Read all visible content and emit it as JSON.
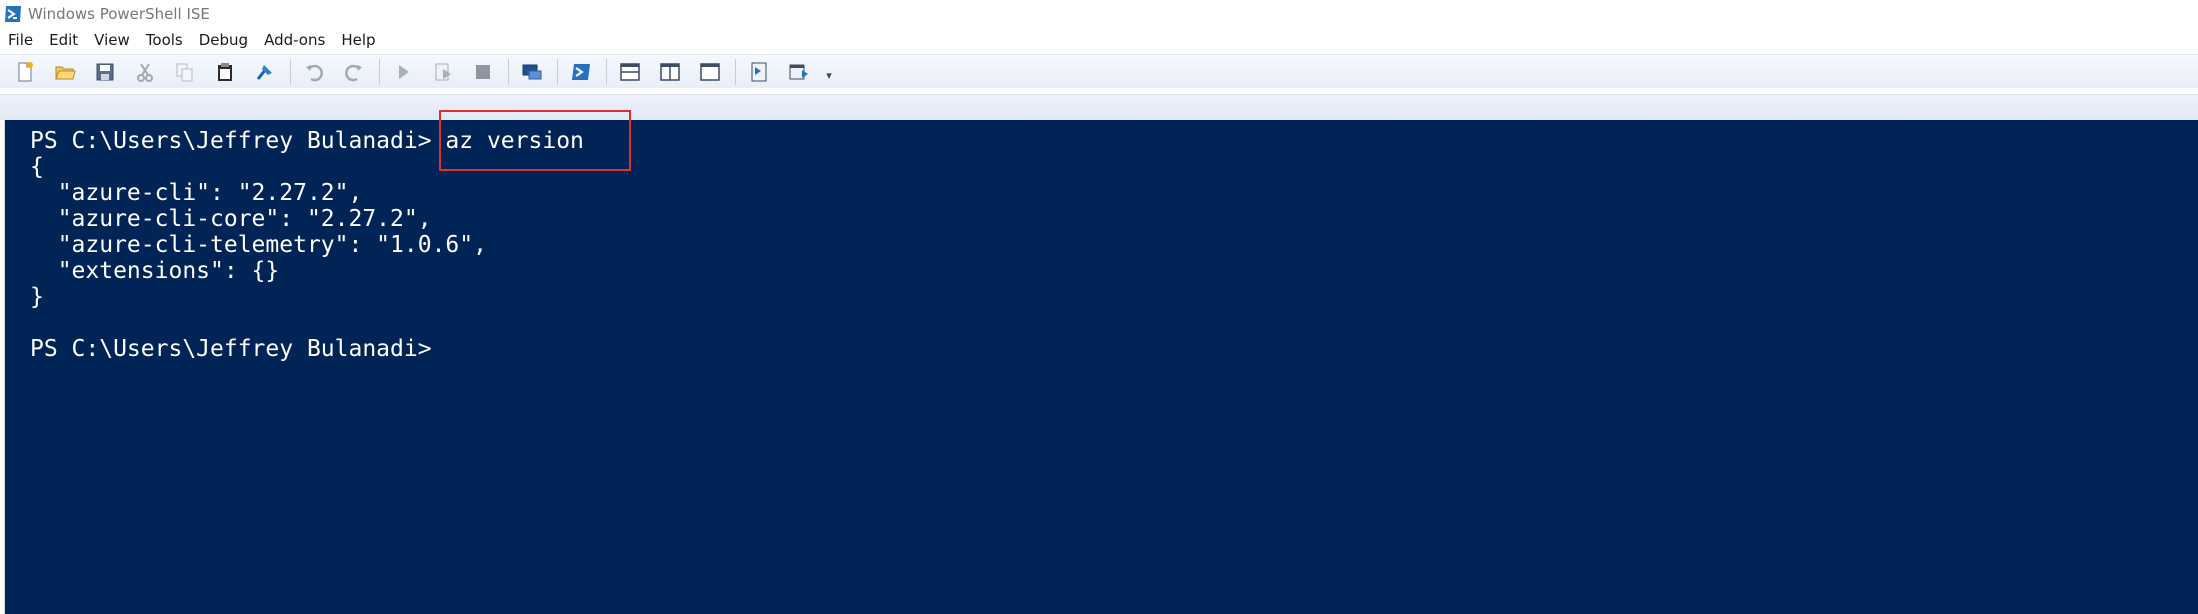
{
  "window": {
    "title": "Windows PowerShell ISE"
  },
  "menu": {
    "items": [
      "File",
      "Edit",
      "View",
      "Tools",
      "Debug",
      "Add-ons",
      "Help"
    ]
  },
  "toolbar": {
    "buttons": [
      "new-file-icon",
      "open-folder-icon",
      "save-icon",
      "cut-icon",
      "copy-icon",
      "paste-icon",
      "clear-console-icon",
      "undo-icon",
      "redo-icon",
      "run-script-icon",
      "run-selection-icon",
      "stop-icon",
      "new-remote-tab-icon",
      "start-powershell-icon",
      "show-script-pane-top-icon",
      "show-script-pane-right-icon",
      "show-script-pane-maximized-icon",
      "show-command-window-icon",
      "show-command-addon-icon"
    ],
    "overflow": "▾"
  },
  "console": {
    "lines": [
      "PS C:\\Users\\Jeffrey Bulanadi> az version",
      "{",
      "  \"azure-cli\": \"2.27.2\",",
      "  \"azure-cli-core\": \"2.27.2\",",
      "  \"azure-cli-telemetry\": \"1.0.6\",",
      "  \"extensions\": {}",
      "}",
      "",
      "PS C:\\Users\\Jeffrey Bulanadi>"
    ],
    "highlighted_command": "az version"
  },
  "colors": {
    "console_background": "#012456",
    "console_text": "#ffffff",
    "highlight_border": "#e0302f",
    "toolbar_gradient_top": "#f5f8fd",
    "toolbar_gradient_bottom": "#e8eef8"
  }
}
